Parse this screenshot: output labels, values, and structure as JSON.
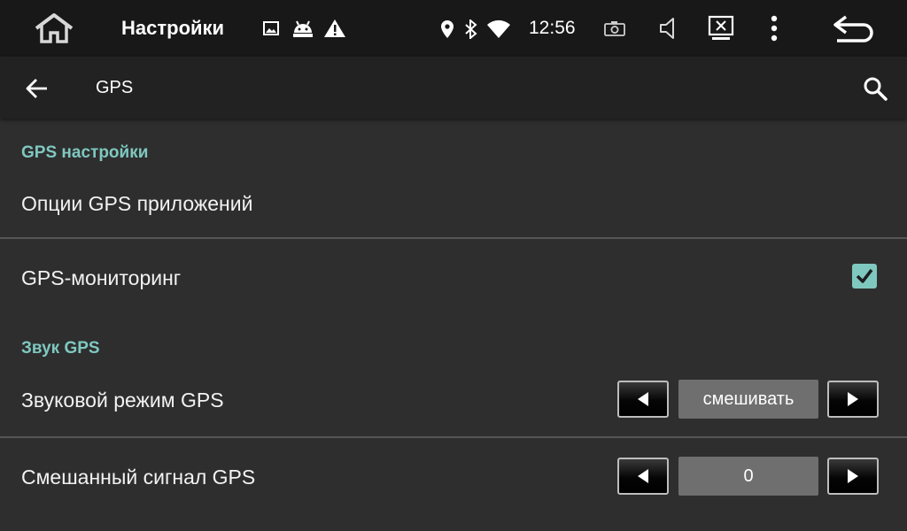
{
  "statusbar": {
    "title": "Настройки",
    "time": "12:56",
    "icons": [
      "home-icon",
      "image-icon",
      "android-icon",
      "warning-icon",
      "location-icon",
      "bluetooth-icon",
      "wifi-icon",
      "camera-icon",
      "volume-icon",
      "screen-close-icon",
      "more-vert-icon",
      "back-return-icon"
    ]
  },
  "actionbar": {
    "title": "GPS",
    "icons": [
      "arrow-back-icon",
      "search-icon"
    ]
  },
  "sections": {
    "gps_settings_header": "GPS настройки",
    "gps_app_options": "Опции GPS приложений",
    "gps_monitoring": "GPS-мониторинг",
    "gps_monitoring_checked": true,
    "gps_sound_header": "Звук GPS",
    "gps_sound_mode": "Звуковой режим GPS",
    "gps_sound_mode_value": "смешивать",
    "gps_mixed_signal": "Смешанный сигнал GPS",
    "gps_mixed_signal_value": "0"
  },
  "colors": {
    "accent": "#7fc8c0",
    "background": "#2e2e2e",
    "statusbar": "#181818",
    "actionbar": "#222222"
  }
}
